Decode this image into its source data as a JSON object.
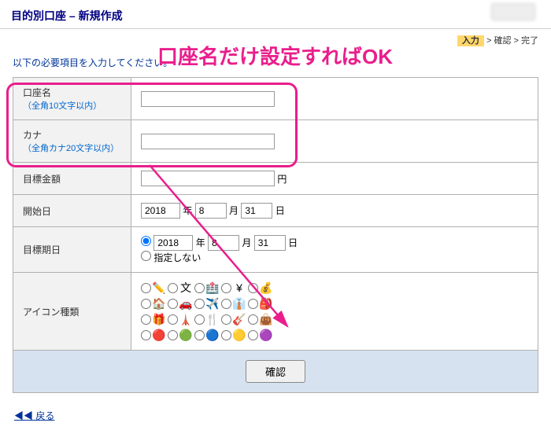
{
  "page": {
    "title": "目的別口座 – 新規作成",
    "steps": {
      "step1": "入力",
      "sep": " > ",
      "step2": "確認",
      "step3": "完了"
    },
    "instructions": "以下の必要項目を入力してください。"
  },
  "callout": {
    "text": "口座名だけ設定すればOK"
  },
  "form": {
    "account_name": {
      "label": "口座名",
      "hint": "（全角10文字以内）",
      "value": ""
    },
    "kana": {
      "label": "カナ",
      "hint": "（全角カナ20文字以内）",
      "value": ""
    },
    "target_amount": {
      "label": "目標金額",
      "value": "",
      "unit": "円"
    },
    "start_date": {
      "label": "開始日",
      "year": "2018",
      "month": "8",
      "day": "31",
      "y": "年",
      "m": "月",
      "d": "日"
    },
    "target_date": {
      "label": "目標期日",
      "year": "2018",
      "month": "8",
      "day": "31",
      "y": "年",
      "m": "月",
      "d": "日",
      "not_specify": "指定しない"
    },
    "icon_type": {
      "label": "アイコン種類",
      "rows": [
        [
          "✏️",
          "文",
          "🏥",
          "¥",
          "💰"
        ],
        [
          "🏠",
          "🚗",
          "✈️",
          "👔",
          "🎒"
        ],
        [
          "🎁",
          "🗼",
          "🍴",
          "🎸",
          "👜"
        ],
        [
          "🔴",
          "🟢",
          "🔵",
          "🟡",
          "🟣"
        ]
      ]
    }
  },
  "buttons": {
    "confirm": "確認",
    "back": "◀◀ 戻る"
  }
}
